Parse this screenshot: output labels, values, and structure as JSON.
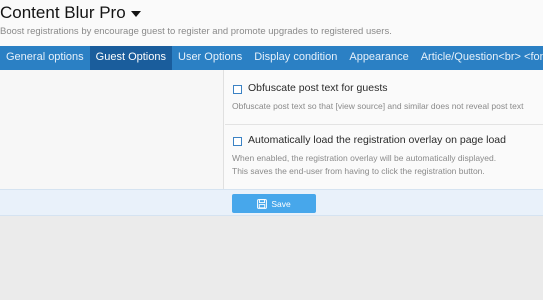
{
  "page": {
    "title": "Content Blur Pro",
    "subtitle": "Boost registrations by encourage guest to register and promote upgrades to registered users."
  },
  "tabs": [
    {
      "label": "General options"
    },
    {
      "label": "Guest Options"
    },
    {
      "label": "User Options"
    },
    {
      "label": "Display condition"
    },
    {
      "label": "Appearance"
    },
    {
      "label": "Article/Question<br> <font"
    }
  ],
  "active_tab": "Guest Options",
  "options": [
    {
      "label": "Obfuscate post text for guests",
      "description": [
        "Obfuscate post text so that [view source] and similar does not reveal post text"
      ],
      "checked": false
    },
    {
      "label": "Automatically load the registration overlay on page load",
      "description": [
        "When enabled, the registration overlay will be automatically displayed.",
        "This saves the end-user from having to click the registration button."
      ],
      "checked": false
    }
  ],
  "actions": {
    "save_label": "Save"
  },
  "colors": {
    "tab_bar": "#2b80c4",
    "tab_active": "#1a5d9c",
    "save_button": "#47a7eb"
  },
  "icons": {
    "title_caret": "caret-down-icon",
    "save": "floppy-disk-icon"
  }
}
